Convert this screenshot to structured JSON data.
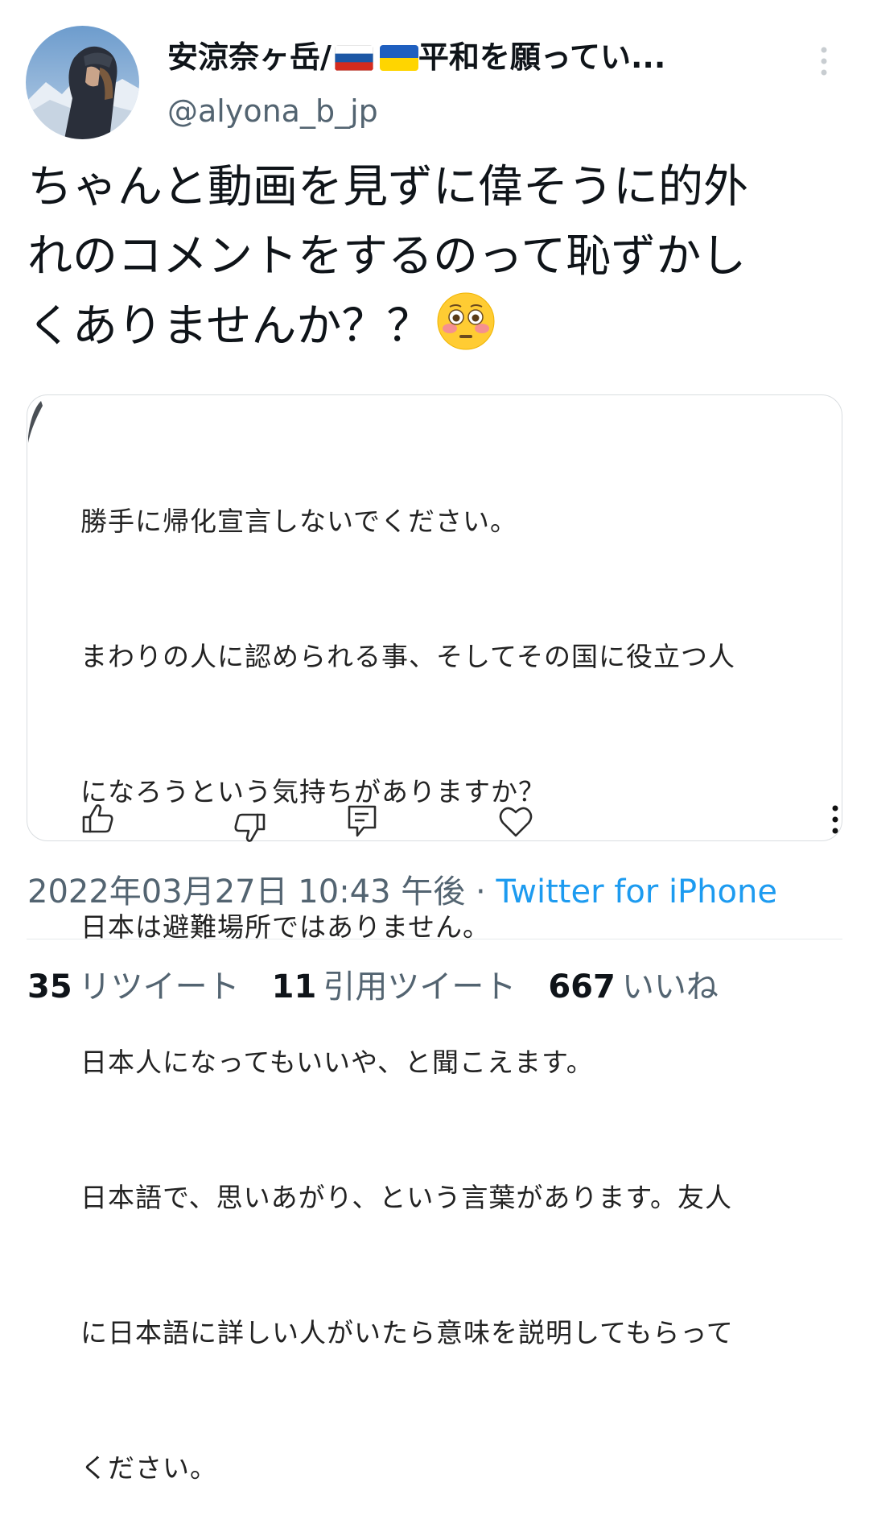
{
  "tweet": {
    "author": {
      "display_name": "安涼奈ヶ岳/",
      "display_name_tail": "平和を願ってい...",
      "handle": "@alyona_b_jp",
      "flags": [
        "russia-flag",
        "ukraine-flag"
      ]
    },
    "text": "ちゃんと動画を見ずに偉そうに的外\nれのコメントをするのって恥ずかし\nくありませんか？？",
    "emoji": "flushed-face-emoji",
    "quoted_comment": {
      "lines": [
        "勝手に帰化宣言しないでください。",
        "まわりの人に認められる事、そしてその国に役立つ人",
        "になろうという気持ちがありますか？",
        "日本は避難場所ではありません。",
        "日本人になってもいいや、と聞こえます。",
        "日本語で、思いあがり、という言葉があります。友人",
        "に日本語に詳しい人がいたら意味を説明してもらって",
        "ください。"
      ],
      "actions": [
        "thumbs-up-icon",
        "thumbs-down-icon",
        "reply-comment-icon",
        "heart-icon",
        "more-vertical-icon"
      ]
    },
    "timestamp": "2022年03月27日 10:43 午後",
    "separator": "·",
    "source": "Twitter for iPhone",
    "stats": {
      "retweets_count": "35",
      "retweets_label": "リツイート",
      "quotes_count": "11",
      "quotes_label": "引用ツイート",
      "likes_count": "667",
      "likes_label": "いいね"
    }
  },
  "colors": {
    "text_primary": "#0f1419",
    "text_secondary": "#536471",
    "link": "#1d9bf0",
    "border": "#d9dde0"
  }
}
